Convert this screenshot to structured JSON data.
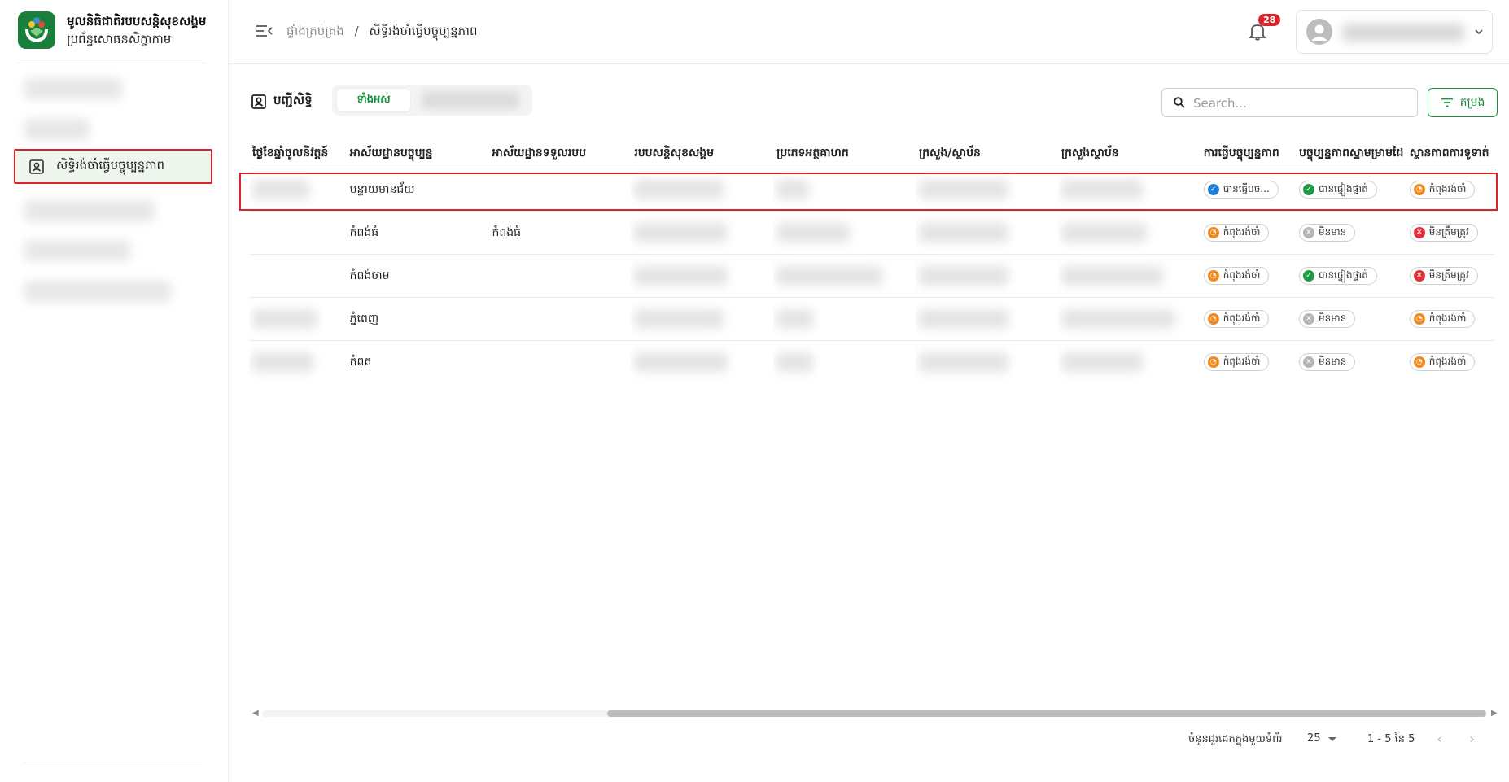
{
  "brand": {
    "title": "មូលនិធិជាតិរបបសន្តិសុខសង្គម",
    "subtitle": "ប្រព័ន្ធសោធនសិក្ខាកាម"
  },
  "sidebar": {
    "active_item": "សិទ្ធិរង់ចាំធ្វើបច្ចុប្បន្នភាព"
  },
  "header": {
    "breadcrumb_root": "ផ្ទាំងគ្រប់គ្រង",
    "breadcrumb_sep": "/",
    "breadcrumb_current": "សិទ្ធិរង់ចាំធ្វើបច្ចុប្បន្នភាព",
    "notification_count": "28"
  },
  "toolbar": {
    "list_title": "បញ្ជីសិទ្ធិ",
    "tab_all": "ទាំងអស់",
    "search_placeholder": "Search...",
    "filter_label": "តម្រង"
  },
  "table": {
    "columns": [
      "ថ្ងៃខែឆ្នាំចូលនិវត្តន៍",
      "អាស័យដ្ឋានបច្ចុប្បន្ន",
      "អាស័យដ្ឋានទទួលរបប",
      "របបសន្តិសុខសង្គម",
      "ប្រភេទអត្ថគាហក",
      "ក្រសួង/ស្ថាប័ន",
      "ក្រសួងស្ថាប័ន",
      "ការធ្វើបច្ចុប្បន្នភាព",
      "បច្ចុប្បន្នភាពស្នាមម្រាមដៃ",
      "ស្ថានភាពការទូទាត់"
    ],
    "rows": [
      {
        "current_address": "បន្ទាយមានជ័យ",
        "receive_address": "",
        "update_status": "បានធ្វើបច្...",
        "fingerprint_status": "បានផ្ទៀងផ្ទាត់",
        "payment_status": "កំពុងរង់ចាំ"
      },
      {
        "current_address": "កំពង់ធំ",
        "receive_address": "កំពង់ធំ",
        "update_status": "កំពុងរង់ចាំ",
        "fingerprint_status": "មិនមាន",
        "payment_status": "មិនត្រឹមត្រូវ"
      },
      {
        "current_address": "កំពង់ចាម",
        "receive_address": "",
        "update_status": "កំពុងរង់ចាំ",
        "fingerprint_status": "បានផ្ទៀងផ្ទាត់",
        "payment_status": "មិនត្រឹមត្រូវ"
      },
      {
        "current_address": "ភ្នំពេញ",
        "receive_address": "",
        "update_status": "កំពុងរង់ចាំ",
        "fingerprint_status": "មិនមាន",
        "payment_status": "កំពុងរង់ចាំ"
      },
      {
        "current_address": "កំពត",
        "receive_address": "",
        "update_status": "កំពុងរង់ចាំ",
        "fingerprint_status": "មិនមាន",
        "payment_status": "កំពុងរង់ចាំ"
      }
    ]
  },
  "pagination": {
    "rows_per_page_label": "ចំនួនជួរដេកក្នុងមួយទំព័រ",
    "rows_per_page": "25",
    "range": "1 - 5 នៃ 5"
  },
  "colors": {
    "brand_green": "#1a8f3c",
    "highlight_red": "#d9242b",
    "pending_orange": "#f08a1c",
    "verified_green": "#1e9b45",
    "updated_blue": "#1f7fd6",
    "none_grey": "#b5b5b5",
    "invalid_red": "#e0313a"
  }
}
